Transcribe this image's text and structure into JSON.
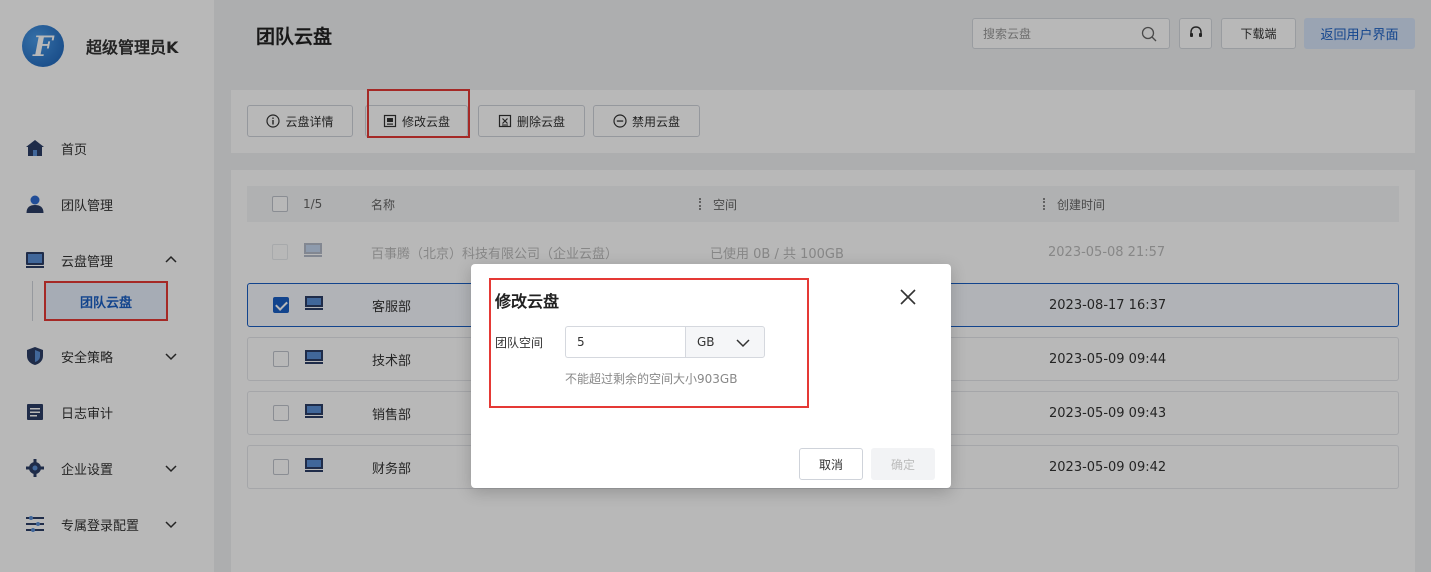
{
  "sidebar": {
    "brand_logo_letter": "F",
    "brand_name": "超级管理员K",
    "items": [
      {
        "label": "首页",
        "icon": "home-icon"
      },
      {
        "label": "团队管理",
        "icon": "user-icon"
      },
      {
        "label": "云盘管理",
        "icon": "cloud-drive-icon",
        "expanded": true
      },
      {
        "label": "安全策略",
        "icon": "shield-icon"
      },
      {
        "label": "日志审计",
        "icon": "log-icon"
      },
      {
        "label": "企业设置",
        "icon": "gear-icon"
      },
      {
        "label": "专属登录配置",
        "icon": "sliders-icon"
      }
    ],
    "sub_item": "团队云盘"
  },
  "header": {
    "title": "团队云盘",
    "search_placeholder": "搜索云盘",
    "download_label": "下载端",
    "return_label": "返回用户界面"
  },
  "toolbar": {
    "details": "云盘详情",
    "modify": "修改云盘",
    "delete": "删除云盘",
    "disable": "禁用云盘"
  },
  "table": {
    "selection": "1/5",
    "columns": [
      "名称",
      "空间",
      "创建时间"
    ],
    "rows": [
      {
        "name": "百事腾（北京）科技有限公司（企业云盘）",
        "space": "已使用 0B / 共 100GB",
        "created": "2023-05-08 21:57",
        "checked": false,
        "disabled": true
      },
      {
        "name": "客服部",
        "space": "",
        "created": "2023-08-17 16:37",
        "checked": true
      },
      {
        "name": "技术部",
        "space": "",
        "created": "2023-05-09 09:44",
        "checked": false
      },
      {
        "name": "销售部",
        "space": "",
        "created": "2023-05-09 09:43",
        "checked": false
      },
      {
        "name": "财务部",
        "space": "",
        "created": "2023-05-09 09:42",
        "checked": false
      }
    ]
  },
  "modal": {
    "title": "修改云盘",
    "field_label": "团队空间",
    "field_value": "5",
    "unit": "GB",
    "hint": "不能超过剩余的空间大小903GB",
    "cancel": "取消",
    "ok": "确定"
  },
  "colors": {
    "accent": "#1a5fc4",
    "highlight": "#e53935"
  }
}
